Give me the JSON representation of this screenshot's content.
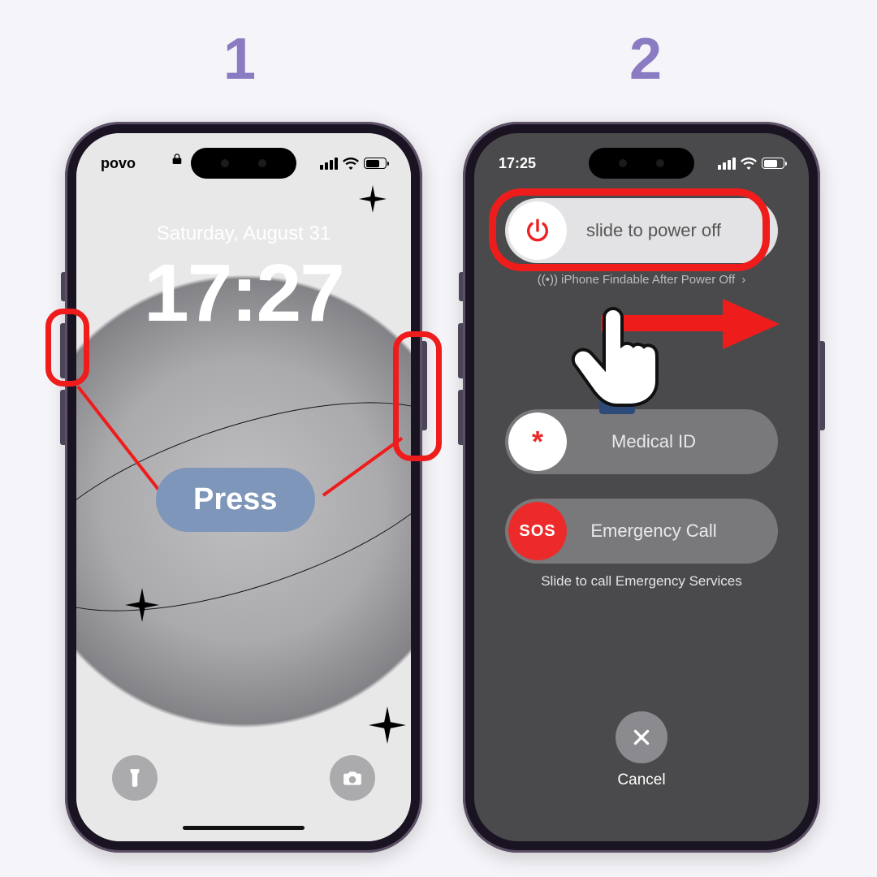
{
  "steps": {
    "one": "1",
    "two": "2"
  },
  "annotation": {
    "press_label": "Press",
    "colors": {
      "highlight": "#ef1c1c",
      "pill_bg": "#7d96b9",
      "step_num": "#8b7bc3"
    }
  },
  "phone1": {
    "status": {
      "carrier": "povo"
    },
    "lock": {
      "date": "Saturday, August 31",
      "time": "17:27"
    },
    "dock": {
      "left_icon": "flashlight-icon",
      "right_icon": "camera-icon"
    }
  },
  "phone2": {
    "status": {
      "time": "17:25"
    },
    "power_off": {
      "label": "slide to power off",
      "findable": "iPhone Findable After Power Off"
    },
    "medical": {
      "label": "Medical ID",
      "knob_glyph": "*"
    },
    "sos": {
      "label": "Emergency Call",
      "knob_text": "SOS",
      "subtext": "Slide to call Emergency Services"
    },
    "cancel": {
      "label": "Cancel"
    }
  }
}
